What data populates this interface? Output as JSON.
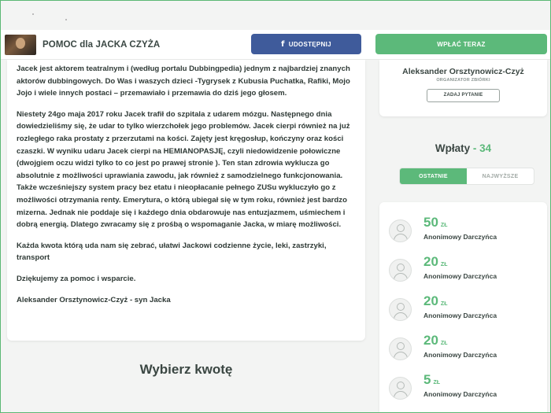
{
  "header": {
    "campaign_title": "POMOC dla JACKA CZYŻA",
    "share_label": "UDOSTĘPNIJ",
    "share_icon": "facebook-icon",
    "pay_label": "WPŁAĆ TERAZ"
  },
  "story": {
    "paragraphs": [
      "Jacek jest aktorem teatralnym i (według portalu Dubbingpedia) jednym z najbardziej znanych aktorów dubbingowych. Do Was i waszych dzieci -Tygrysek z Kubusia Puchatka, Rafiki, Mojo Jojo i wiele innych postaci – przemawiało i przemawia do dziś jego głosem.",
      "Niestety 24go maja 2017 roku Jacek trafił do szpitala z udarem mózgu. Następnego dnia dowiedzieliśmy się, że udar to tylko wierzchołek jego problemów. Jacek cierpi również na już rozległego raka prostaty z przerzutami na kości. Zajęty jest kręgosłup, kończyny oraz kości czaszki. W wyniku udaru Jacek cierpi na HEMIANOPASJĘ, czyli niedowidzenie połowiczne (dwojgiem oczu widzi tylko to co jest po prawej stronie ). Ten stan zdrowia wyklucza go absolutnie z możliwości uprawiania zawodu, jak również z samodzielnego funkcjonowania. Także wcześniejszy system pracy bez etatu i nieopłacanie pełnego ZUSu wykluczyło go z możliwości otrzymania renty. Emerytura, o którą ubiegał się w tym roku, również jest bardzo mizerna. Jednak nie poddaje się i każdego dnia obdarowuje nas entuzjazmem, uśmiechem i dobrą energią. Dlatego zwracamy się z prośbą o wspomaganie Jacka, w miarę możliwości.",
      "Każda kwota którą uda nam się zebrać, ułatwi Jackowi codzienne życie, leki, zastrzyki, transport",
      "Dziękujemy za pomoc i wsparcie.",
      "Aleksander Orsztynowicz-Czyż - syn Jacka"
    ],
    "choose_amount_title": "Wybierz kwotę"
  },
  "organizer": {
    "name": "Aleksander Orsztynowicz-Czyż",
    "role": "ORGANIZATOR ZBIÓRKI",
    "ask_label": "ZADAJ PYTANIE"
  },
  "payments": {
    "title": "Wpłaty",
    "separator": " - ",
    "count": "34",
    "tabs": {
      "latest": "OSTATNIE",
      "highest": "NAJWYŻSZE"
    },
    "currency": "ZŁ",
    "items": [
      {
        "amount": "50",
        "donor": "Anonimowy Darczyńca"
      },
      {
        "amount": "20",
        "donor": "Anonimowy Darczyńca"
      },
      {
        "amount": "20",
        "donor": "Anonimowy Darczyńca"
      },
      {
        "amount": "20",
        "donor": "Anonimowy Darczyńca"
      },
      {
        "amount": "5",
        "donor": "Anonimowy Darczyńca"
      }
    ]
  },
  "colors": {
    "accent": "#5cb97a",
    "facebook": "#3f5b9b",
    "text": "#2f3a36"
  }
}
